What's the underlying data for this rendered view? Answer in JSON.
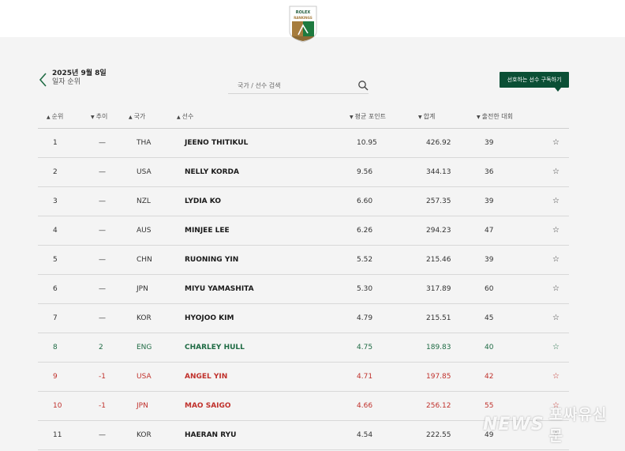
{
  "header": {
    "logo": "rolex-rankings-logo",
    "logo_brand": "ROLEX",
    "logo_text": "RANKINGS"
  },
  "date": {
    "line1": "2025년 9월 8일",
    "line2": "일자 순위"
  },
  "search": {
    "placeholder": "국가 / 선수 검색",
    "value": ""
  },
  "subscribe_label": "선호하는 선수 구독하기",
  "columns": {
    "rank": "순위",
    "movement": "추이",
    "nation": "국가",
    "player": "선수",
    "avg": "평균 포인트",
    "total": "합계",
    "events": "출전한 대회"
  },
  "rows": [
    {
      "rank": "1",
      "move": "—",
      "nat": "THA",
      "name": "JEENO THITIKUL",
      "avg": "10.95",
      "total": "426.92",
      "events": "39",
      "trend": "same"
    },
    {
      "rank": "2",
      "move": "—",
      "nat": "USA",
      "name": "NELLY KORDA",
      "avg": "9.56",
      "total": "344.13",
      "events": "36",
      "trend": "same"
    },
    {
      "rank": "3",
      "move": "—",
      "nat": "NZL",
      "name": "LYDIA KO",
      "avg": "6.60",
      "total": "257.35",
      "events": "39",
      "trend": "same"
    },
    {
      "rank": "4",
      "move": "—",
      "nat": "AUS",
      "name": "MINJEE LEE",
      "avg": "6.26",
      "total": "294.23",
      "events": "47",
      "trend": "same"
    },
    {
      "rank": "5",
      "move": "—",
      "nat": "CHN",
      "name": "RUONING YIN",
      "avg": "5.52",
      "total": "215.46",
      "events": "39",
      "trend": "same"
    },
    {
      "rank": "6",
      "move": "—",
      "nat": "JPN",
      "name": "MIYU YAMASHITA",
      "avg": "5.30",
      "total": "317.89",
      "events": "60",
      "trend": "same"
    },
    {
      "rank": "7",
      "move": "—",
      "nat": "KOR",
      "name": "HYOJOO KIM",
      "avg": "4.79",
      "total": "215.51",
      "events": "45",
      "trend": "same"
    },
    {
      "rank": "8",
      "move": "2",
      "nat": "ENG",
      "name": "CHARLEY HULL",
      "avg": "4.75",
      "total": "189.83",
      "events": "40",
      "trend": "up"
    },
    {
      "rank": "9",
      "move": "-1",
      "nat": "USA",
      "name": "ANGEL YIN",
      "avg": "4.71",
      "total": "197.85",
      "events": "42",
      "trend": "down"
    },
    {
      "rank": "10",
      "move": "-1",
      "nat": "JPN",
      "name": "MAO SAIGO",
      "avg": "4.66",
      "total": "256.12",
      "events": "55",
      "trend": "down"
    },
    {
      "rank": "11",
      "move": "—",
      "nat": "KOR",
      "name": "HAERAN RYU",
      "avg": "4.54",
      "total": "222.55",
      "events": "49",
      "trend": "same"
    }
  ],
  "watermark": {
    "mark": "NEWS",
    "text": "포싸유신문"
  },
  "colors": {
    "accent": "#0b4f35",
    "up": "#1f6b44",
    "down": "#c0312c"
  }
}
